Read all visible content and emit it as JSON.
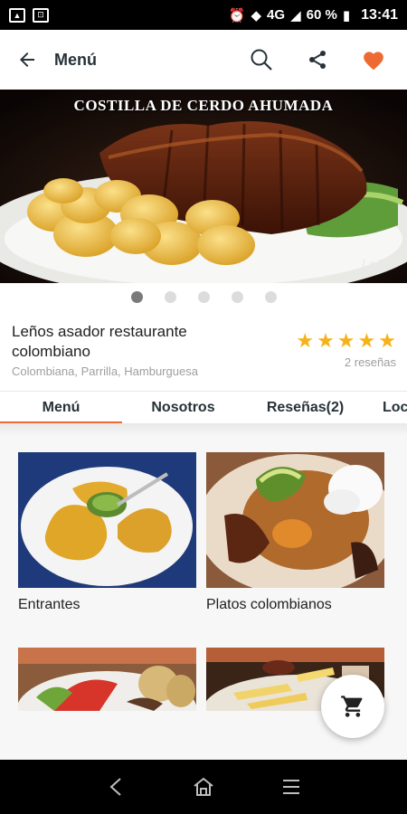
{
  "status_bar": {
    "network": "4G",
    "battery": "60 %",
    "time": "13:41"
  },
  "app_bar": {
    "title": "Menú",
    "icons": [
      "back-arrow-icon",
      "search-icon",
      "share-icon",
      "heart-icon"
    ]
  },
  "hero": {
    "caption": "COSTILLA  DE CERDO AHUMADA",
    "watermark": "Leños"
  },
  "carousel": {
    "count": 5,
    "active_index": 0
  },
  "restaurant": {
    "name": "Leños asador restaurante colombiano",
    "categories": "Colombiana, Parrilla, Hamburguesa",
    "rating": 5,
    "reviews": "2 reseñas"
  },
  "tabs": [
    {
      "label": "Menú",
      "active": true
    },
    {
      "label": "Nosotros",
      "active": false
    },
    {
      "label": "Reseñas(2)",
      "active": false
    },
    {
      "label": "Loc",
      "active": false
    }
  ],
  "menu_categories": [
    {
      "label": "Entrantes"
    },
    {
      "label": "Platos colombianos"
    },
    {
      "label": ""
    },
    {
      "label": ""
    }
  ],
  "colors": {
    "accent": "#ee6a33",
    "star": "#f6b21a",
    "heart": "#ee6a33"
  }
}
